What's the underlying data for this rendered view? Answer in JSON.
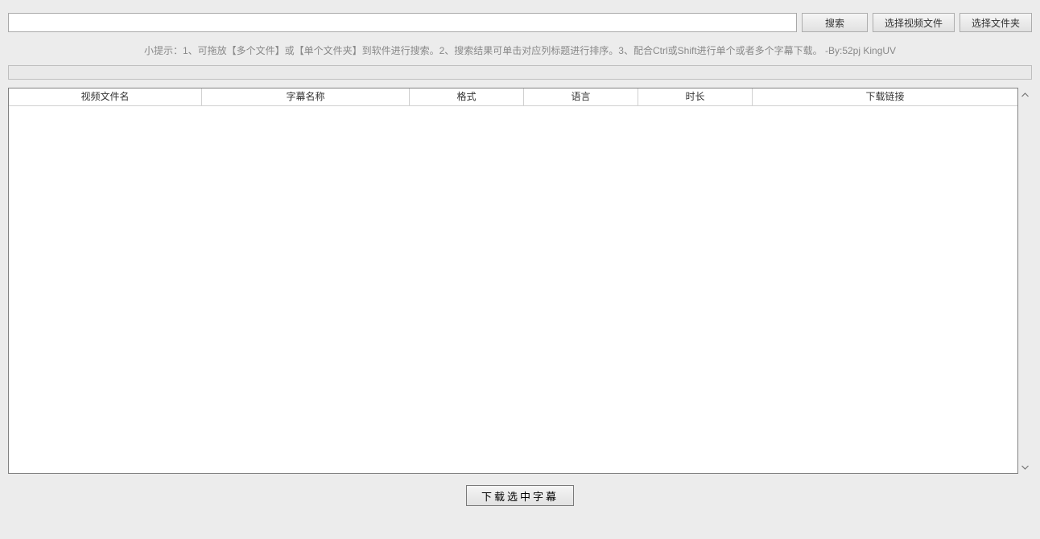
{
  "toolbar": {
    "search_value": "",
    "search_btn": "搜索",
    "select_video_btn": "选择视频文件",
    "select_folder_btn": "选择文件夹"
  },
  "hint_text": "小提示：1、可拖放【多个文件】或【单个文件夹】到软件进行搜索。2、搜索结果可单击对应列标题进行排序。3、配合Ctrl或Shift进行单个或者多个字幕下载。 -By:52pj KingUV",
  "status_text": "",
  "columns": {
    "video": "视频文件名",
    "subtitle": "字幕名称",
    "format": "格式",
    "language": "语言",
    "duration": "时长",
    "link": "下载链接"
  },
  "rows": [],
  "footer": {
    "download_btn": "下载选中字幕"
  }
}
